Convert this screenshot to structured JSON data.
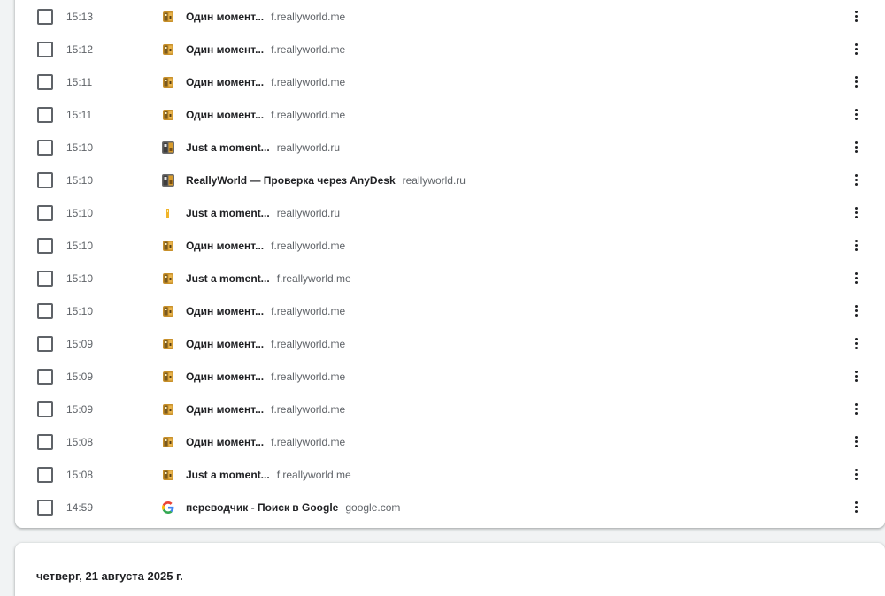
{
  "history": {
    "entries": [
      {
        "time": "15:13",
        "title": "Один момент...",
        "domain": "f.reallyworld.me",
        "icon": "reallyworld-favicon-orange"
      },
      {
        "time": "15:12",
        "title": "Один момент...",
        "domain": "f.reallyworld.me",
        "icon": "reallyworld-favicon-orange"
      },
      {
        "time": "15:11",
        "title": "Один момент...",
        "domain": "f.reallyworld.me",
        "icon": "reallyworld-favicon-orange"
      },
      {
        "time": "15:11",
        "title": "Один момент...",
        "domain": "f.reallyworld.me",
        "icon": "reallyworld-favicon-orange"
      },
      {
        "time": "15:10",
        "title": "Just a moment...",
        "domain": "reallyworld.ru",
        "icon": "reallyworld-favicon-grey"
      },
      {
        "time": "15:10",
        "title": "ReallyWorld — Проверка через AnyDesk",
        "domain": "reallyworld.ru",
        "icon": "reallyworld-favicon-grey"
      },
      {
        "time": "15:10",
        "title": "Just a moment...",
        "domain": "reallyworld.ru",
        "icon": "reallyworld-favicon-yellow"
      },
      {
        "time": "15:10",
        "title": "Один момент...",
        "domain": "f.reallyworld.me",
        "icon": "reallyworld-favicon-orange"
      },
      {
        "time": "15:10",
        "title": "Just a moment...",
        "domain": "f.reallyworld.me",
        "icon": "reallyworld-favicon-orange"
      },
      {
        "time": "15:10",
        "title": "Один момент...",
        "domain": "f.reallyworld.me",
        "icon": "reallyworld-favicon-orange"
      },
      {
        "time": "15:09",
        "title": "Один момент...",
        "domain": "f.reallyworld.me",
        "icon": "reallyworld-favicon-orange"
      },
      {
        "time": "15:09",
        "title": "Один момент...",
        "domain": "f.reallyworld.me",
        "icon": "reallyworld-favicon-orange"
      },
      {
        "time": "15:09",
        "title": "Один момент...",
        "domain": "f.reallyworld.me",
        "icon": "reallyworld-favicon-orange"
      },
      {
        "time": "15:08",
        "title": "Один момент...",
        "domain": "f.reallyworld.me",
        "icon": "reallyworld-favicon-orange"
      },
      {
        "time": "15:08",
        "title": "Just a moment...",
        "domain": "f.reallyworld.me",
        "icon": "reallyworld-favicon-orange"
      },
      {
        "time": "14:59",
        "title": "переводчик - Поиск в Google",
        "domain": "google.com",
        "icon": "google-favicon"
      }
    ],
    "next_day_header": "четверг, 21 августа 2025 г."
  },
  "colors": {
    "background": "#f1f3f4",
    "card": "#ffffff",
    "title_text": "#202124",
    "secondary_text": "#5f6368"
  }
}
